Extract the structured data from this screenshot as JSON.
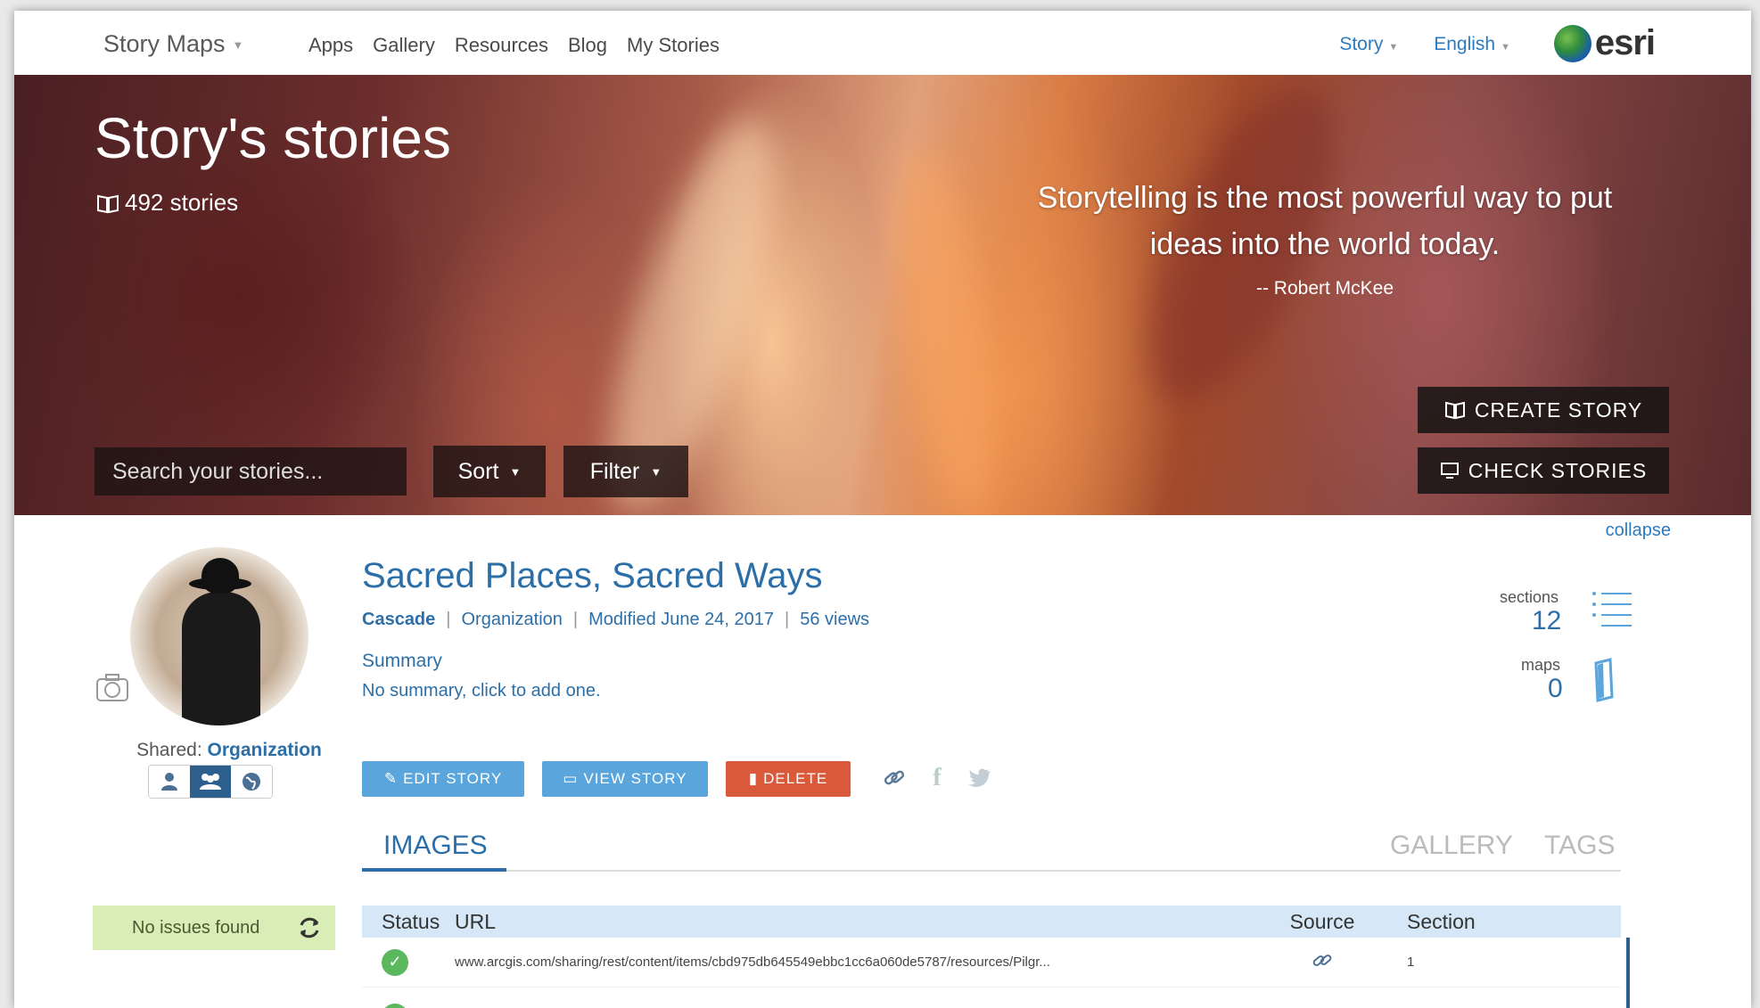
{
  "nav": {
    "brand": "Story Maps",
    "links": [
      "Apps",
      "Gallery",
      "Resources",
      "Blog",
      "My Stories"
    ],
    "story_menu": "Story",
    "language_menu": "English",
    "logo_text": "esri"
  },
  "hero": {
    "title": "Story's stories",
    "story_count": "492 stories",
    "quote": "Storytelling is the most powerful way to put ideas into the world today.",
    "quote_author": "-- Robert McKee",
    "search_placeholder": "Search your stories...",
    "sort_label": "Sort",
    "filter_label": "Filter",
    "create_label": "CREATE STORY",
    "check_label": "CHECK STORIES"
  },
  "story": {
    "collapse_label": "collapse",
    "title": "Sacred Places, Sacred Ways",
    "template": "Cascade",
    "sharing": "Organization",
    "modified": "Modified June 24, 2017",
    "views": "56 views",
    "summary_label": "Summary",
    "summary_text": "No summary, click to add one.",
    "shared_prefix": "Shared:",
    "shared_value": "Organization",
    "sections_label": "sections",
    "sections_count": "12",
    "maps_label": "maps",
    "maps_count": "0",
    "edit_label": "EDIT STORY",
    "view_label": "VIEW STORY",
    "delete_label": "DELETE"
  },
  "tabs": {
    "images": "IMAGES",
    "gallery": "GALLERY",
    "tags": "TAGS"
  },
  "issues": {
    "label": "No issues found"
  },
  "table": {
    "headers": [
      "Status",
      "URL",
      "Source",
      "Section"
    ],
    "rows": [
      {
        "url": "www.arcgis.com/sharing/rest/content/items/cbd975db645549ebbc1cc6a060de5787/resources/Pilgr...",
        "section": "1"
      }
    ]
  }
}
